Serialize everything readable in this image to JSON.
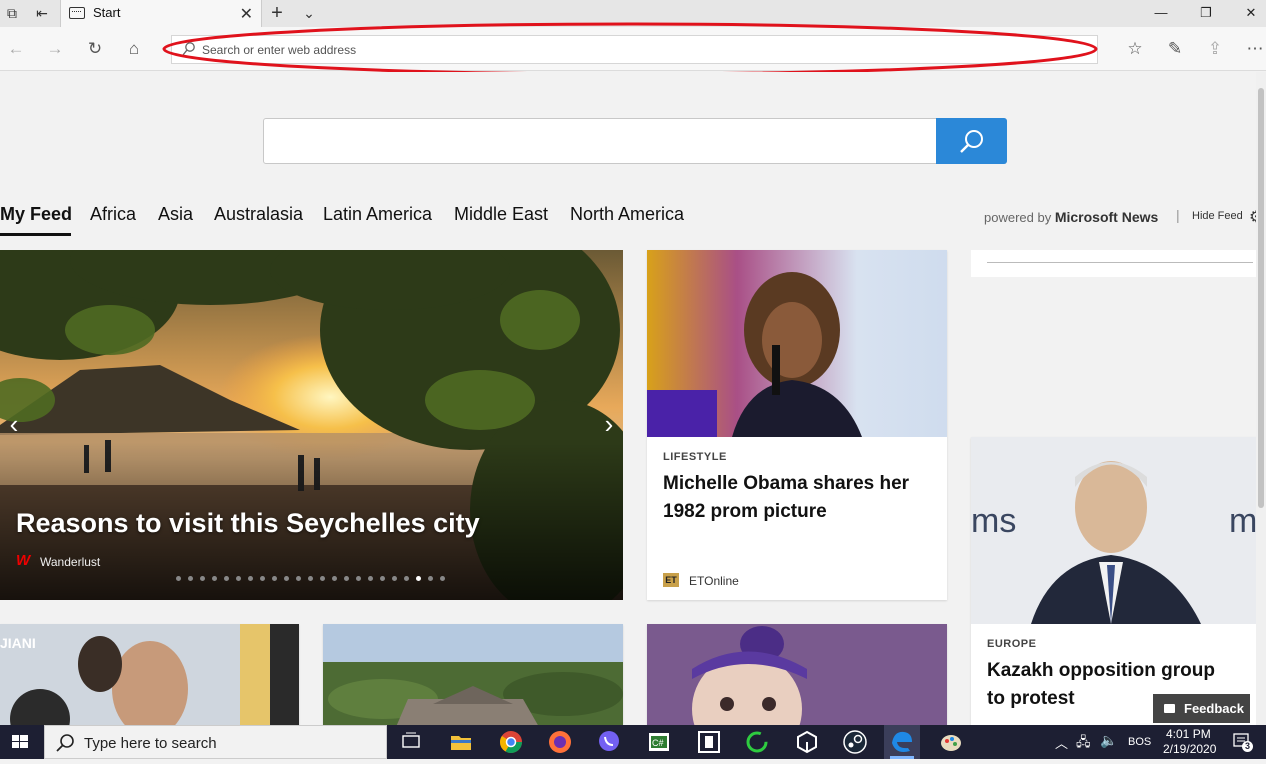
{
  "browser": {
    "tab_title": "Start",
    "address_placeholder": "Search or enter web address"
  },
  "newtab": {
    "search_placeholder": "",
    "feed_tabs": [
      "My Feed",
      "Africa",
      "Asia",
      "Australasia",
      "Latin America",
      "Middle East",
      "North America"
    ],
    "active_tab": "My Feed",
    "powered_prefix": "powered by",
    "powered_brand": "Microsoft News",
    "hide_feed": "Hide Feed"
  },
  "hero": {
    "title": "Reasons to visit this Seychelles city",
    "source": "Wanderlust",
    "carousel_total": 23,
    "carousel_active_index": 20
  },
  "cards": [
    {
      "category": "LIFESTYLE",
      "headline_line1": "Michelle Obama shares her",
      "headline_line2": "1982 prom picture",
      "source": "ETOnline",
      "source_logo": "ET"
    },
    {
      "category": "EUROPE",
      "headline_line1": "Kazakh opposition group",
      "headline_line2": "to protest"
    }
  ],
  "feedback_label": "Feedback",
  "taskbar": {
    "search_text": "Type here to search",
    "language": "BOS",
    "time": "4:01 PM",
    "date": "2/19/2020",
    "notification_count": "3"
  },
  "colors": {
    "accent": "#2b88d8",
    "annotation_red": "#e0121c",
    "taskbar": "#1d1f33"
  }
}
